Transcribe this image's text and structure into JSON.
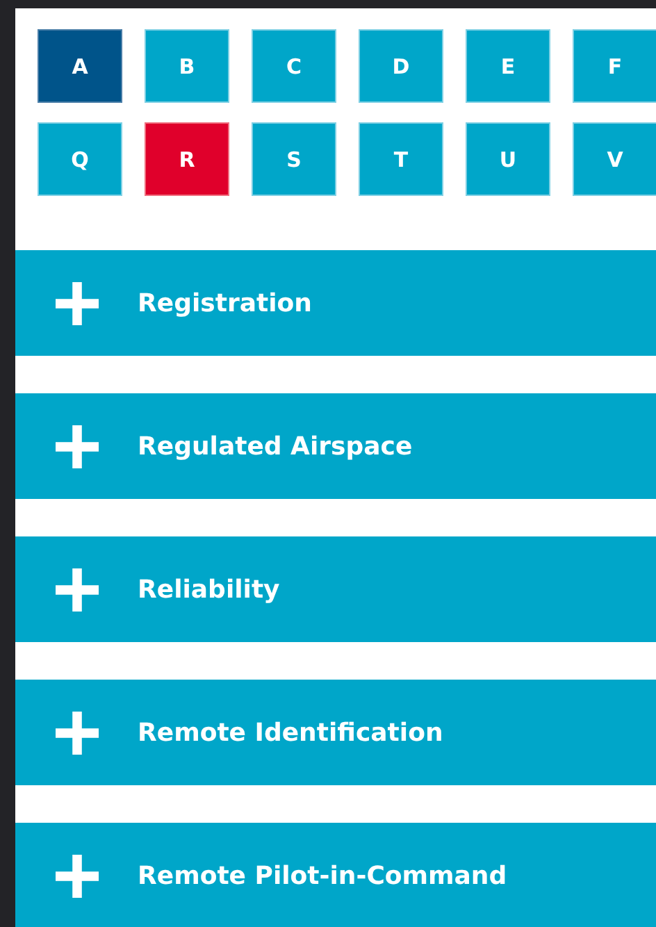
{
  "letters": [
    [
      {
        "label": "A",
        "highlighted": true,
        "selected": false
      },
      {
        "label": "B",
        "highlighted": false,
        "selected": false
      },
      {
        "label": "C",
        "highlighted": false,
        "selected": false
      },
      {
        "label": "D",
        "highlighted": false,
        "selected": false
      },
      {
        "label": "E",
        "highlighted": false,
        "selected": false
      },
      {
        "label": "F",
        "highlighted": false,
        "selected": false
      }
    ],
    [
      {
        "label": "Q",
        "highlighted": false,
        "selected": false
      },
      {
        "label": "R",
        "highlighted": false,
        "selected": true
      },
      {
        "label": "S",
        "highlighted": false,
        "selected": false
      },
      {
        "label": "T",
        "highlighted": false,
        "selected": false
      },
      {
        "label": "U",
        "highlighted": false,
        "selected": false
      },
      {
        "label": "V",
        "highlighted": false,
        "selected": false
      }
    ]
  ],
  "sections": [
    {
      "title": "Registration",
      "expanded": false
    },
    {
      "title": "Regulated Airspace",
      "expanded": false
    },
    {
      "title": "Reliability",
      "expanded": false
    },
    {
      "title": "Remote Identification",
      "expanded": false
    },
    {
      "title": "Remote Pilot-in-Command",
      "expanded": false
    }
  ]
}
